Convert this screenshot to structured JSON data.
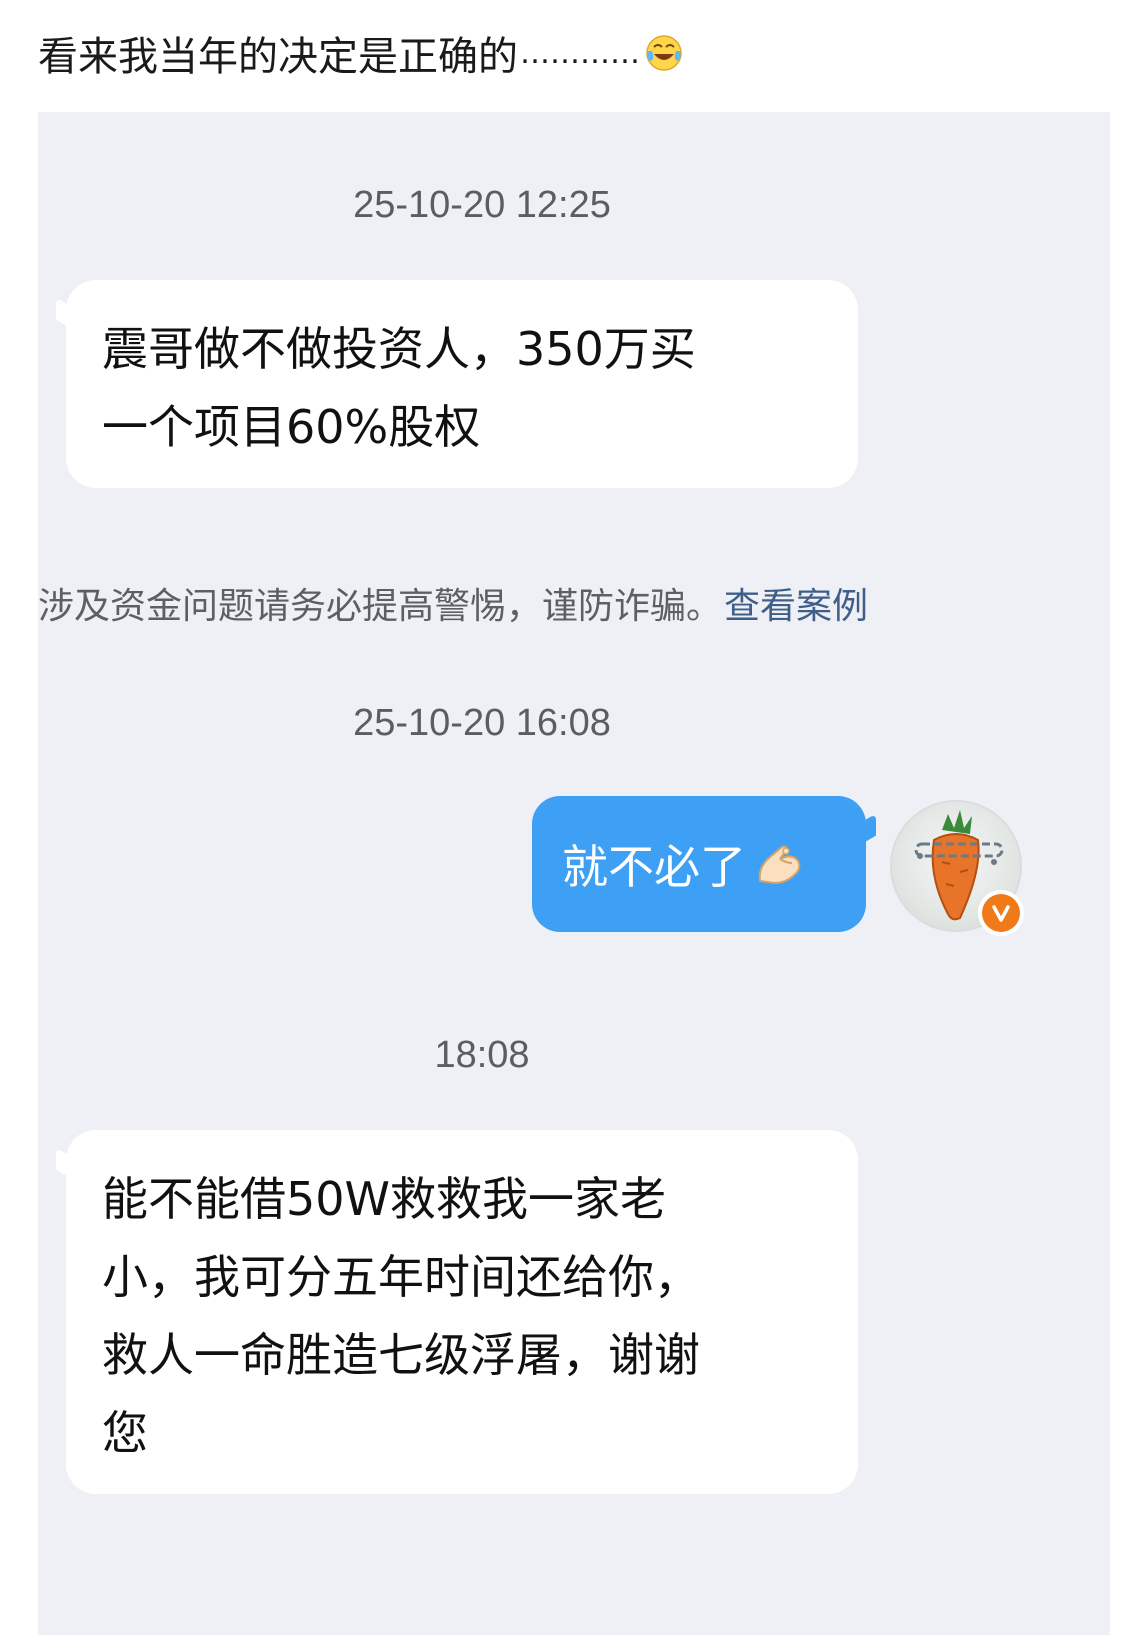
{
  "post": {
    "title": "看来我当年的决定是正确的",
    "dots": "…………",
    "emoji_icon": "tears-of-joy-emoji"
  },
  "chat": {
    "background": "#eef0f5",
    "timestamps": [
      "25-10-20 12:25",
      "25-10-20 16:08",
      "18:08"
    ],
    "messages": [
      {
        "side": "left",
        "lines": [
          "震哥做不做投资人，350万买",
          "一个项目60%股权"
        ]
      },
      {
        "side": "right",
        "text": "就不必了",
        "emoji_icon": "pinching-hand-emoji",
        "bubble_color": "#3da0f5"
      },
      {
        "side": "left",
        "lines": [
          "能不能借50W救救我一家老",
          "小，我可分五年时间还给你，",
          "救人一命胜造七级浮屠，谢谢",
          "您"
        ]
      }
    ],
    "warning": {
      "text": "涉及资金问题请务必提高警惕，谨防诈骗。",
      "link": "查看案例"
    },
    "avatar": {
      "icon": "carrot-avatar-icon",
      "badge_icon": "verified-v-icon",
      "badge_color": "#f07a1a"
    }
  }
}
